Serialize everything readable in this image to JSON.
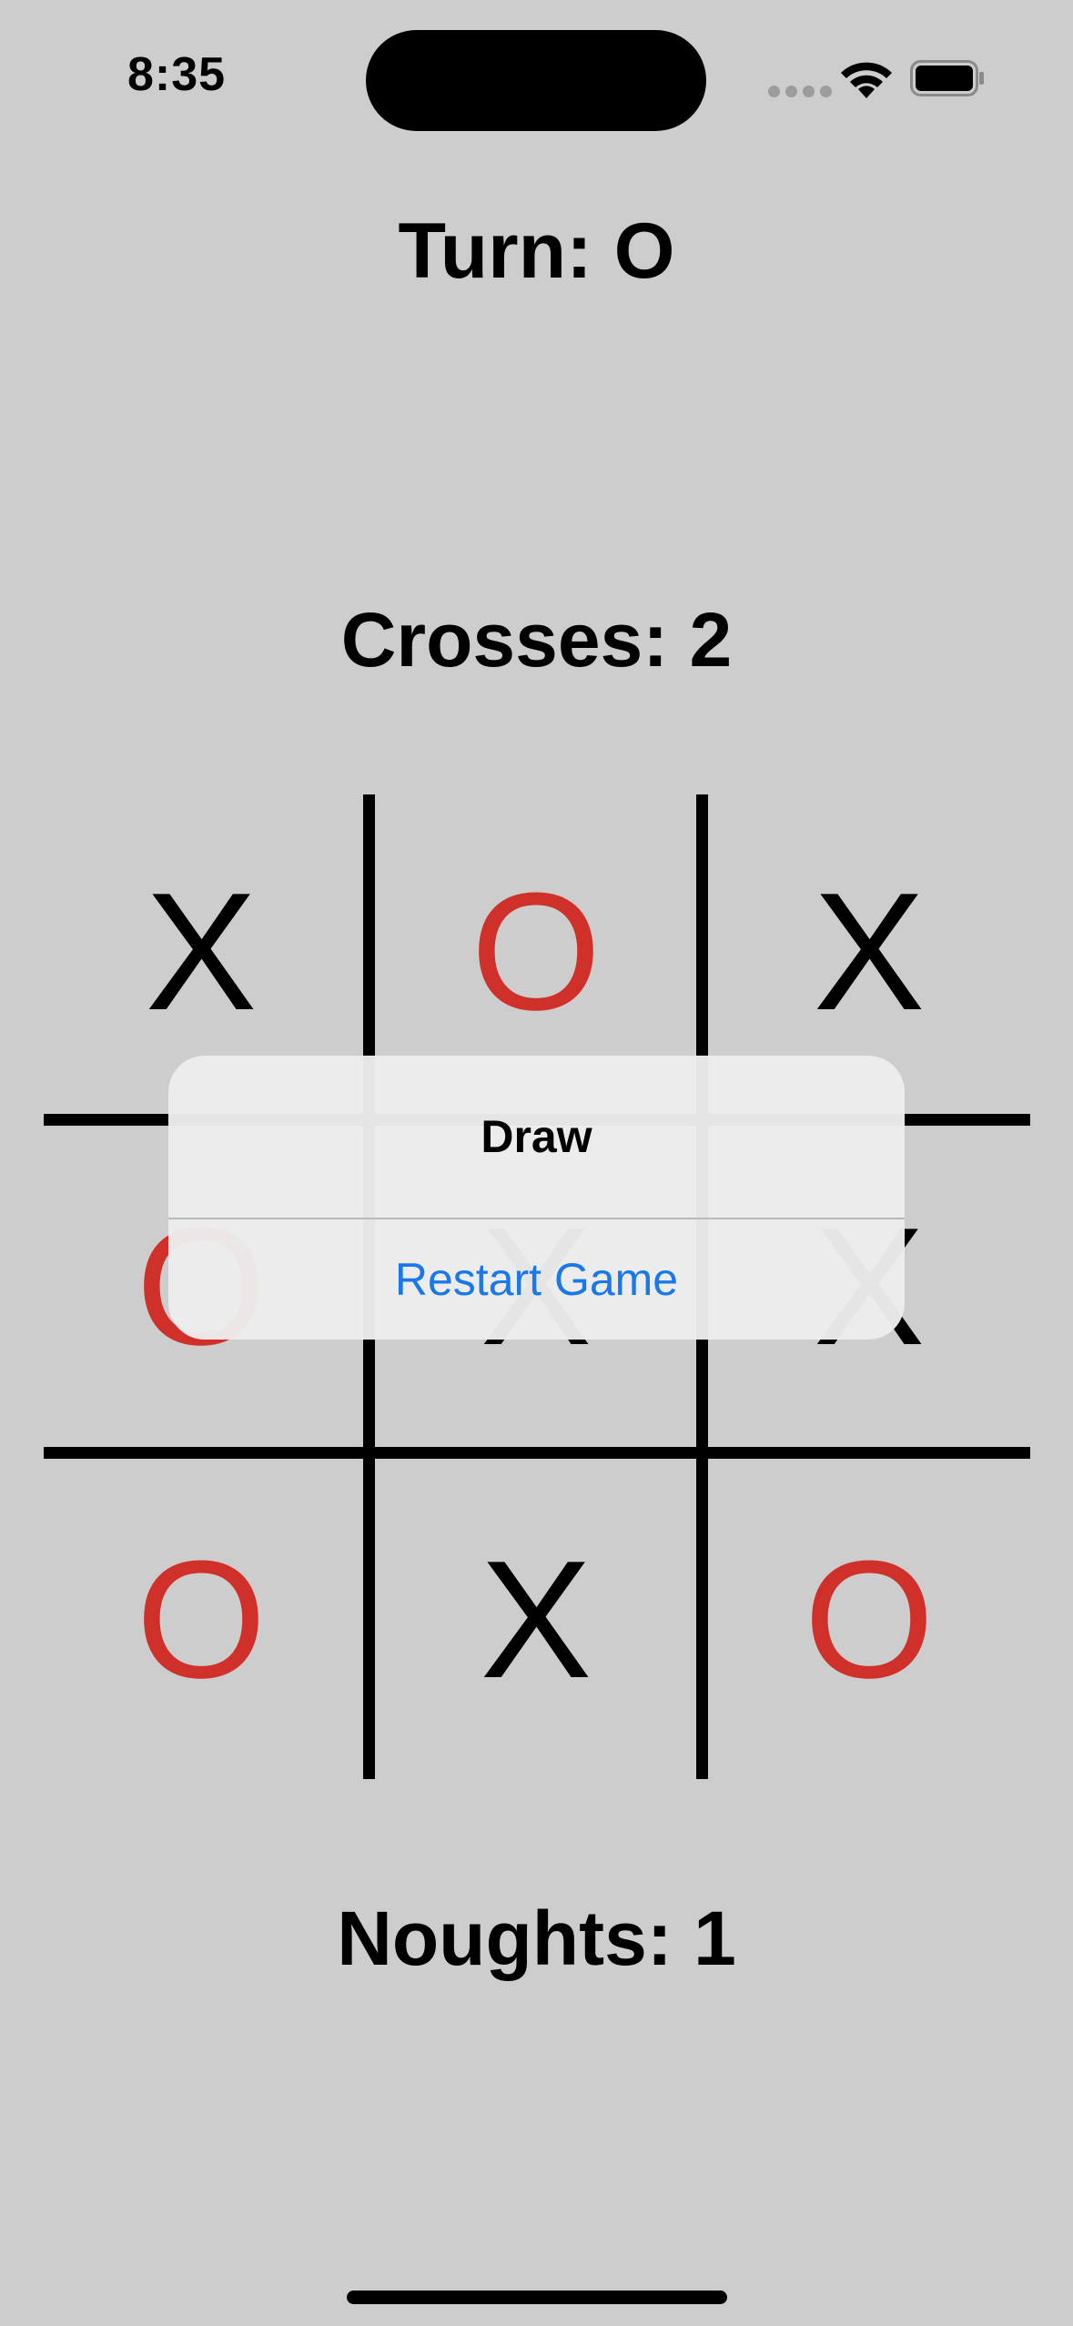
{
  "status_bar": {
    "time": "8:35",
    "icons": [
      "signal-dots-icon",
      "wifi-icon",
      "battery-icon"
    ]
  },
  "game": {
    "turn_label": "Turn: O",
    "crosses_score": "Crosses: 2",
    "noughts_score": "Noughts: 1",
    "colors": {
      "cross": "#000000",
      "nought": "#d0302a"
    },
    "board": [
      [
        "X",
        "O",
        "X"
      ],
      [
        "O",
        "X",
        "X"
      ],
      [
        "O",
        "X",
        "O"
      ]
    ]
  },
  "alert": {
    "title": "Draw",
    "button_label": "Restart Game",
    "button_color": "#1a78e8"
  }
}
